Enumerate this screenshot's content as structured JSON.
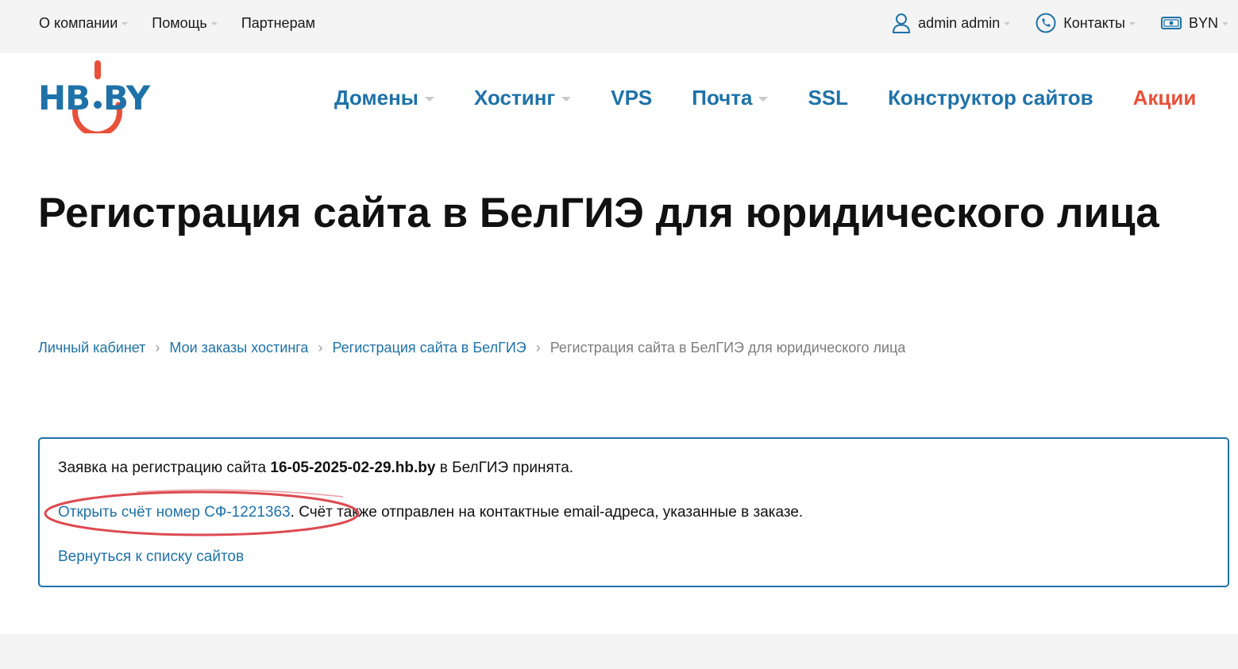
{
  "topbar": {
    "left": [
      {
        "label": "О компании",
        "dropdown": true
      },
      {
        "label": "Помощь",
        "dropdown": true
      },
      {
        "label": "Партнерам",
        "dropdown": false
      }
    ],
    "user": {
      "label": "admin admin",
      "icon": "user-icon"
    },
    "contacts": {
      "label": "Контакты",
      "icon": "phone-icon"
    },
    "currency": {
      "label": "BYN",
      "icon": "money-icon"
    }
  },
  "logo": {
    "text": "HB.BY",
    "colors": {
      "blue": "#1f72a8",
      "red": "#e8503a"
    }
  },
  "nav": {
    "domains": "Домены",
    "hosting": "Хостинг",
    "vps": "VPS",
    "mail": "Почта",
    "ssl": "SSL",
    "builder": "Конструктор сайтов",
    "promo": "Акции"
  },
  "page": {
    "title": "Регистрация сайта в БелГИЭ для юридического лица"
  },
  "breadcrumb": {
    "items": [
      "Личный кабинет",
      "Мои заказы хостинга",
      "Регистрация сайта в БелГИЭ"
    ],
    "current": "Регистрация сайта в БелГИЭ для юридического лица",
    "separator": "›"
  },
  "notice": {
    "line1_prefix": "Заявка на регистрацию сайта ",
    "domain": "16-05-2025-02-29.hb.by",
    "line1_suffix": " в БелГИЭ принята.",
    "invoice_link": "Открыть счёт номер СФ-1221363",
    "line2_suffix": ". Счёт также отправлен на контактные email-адреса, указанные в заказе.",
    "back_link": "Вернуться к списку сайтов"
  },
  "colors": {
    "accent": "#1f72a8",
    "promo": "#e8503a",
    "annotation": "#d9363e",
    "topbar_bg": "#f4f4f4"
  }
}
